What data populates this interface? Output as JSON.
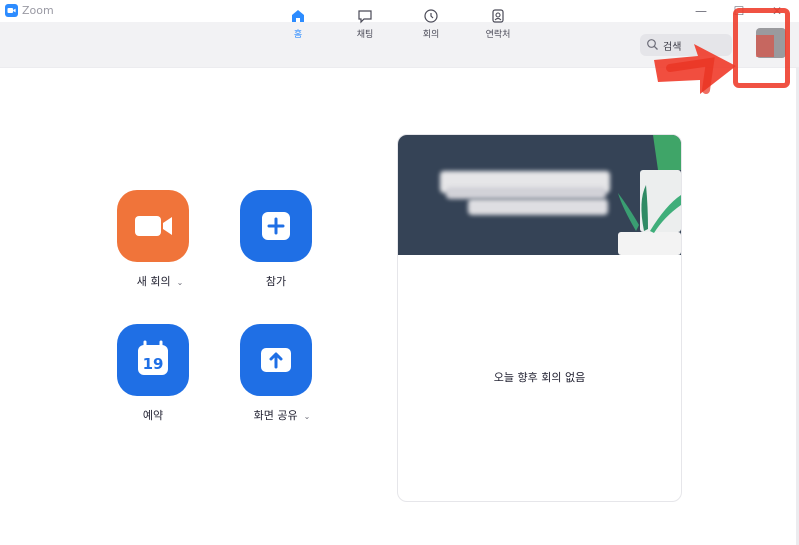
{
  "window": {
    "title": "Zoom",
    "controls": {
      "minimize": "—",
      "maximize": "☐",
      "close": "✕"
    }
  },
  "nav": {
    "tabs": [
      {
        "label": "홈",
        "icon": "home-icon",
        "active": true
      },
      {
        "label": "채팅",
        "icon": "chat-icon",
        "active": false
      },
      {
        "label": "회의",
        "icon": "clock-icon",
        "active": false
      },
      {
        "label": "연락처",
        "icon": "contacts-icon",
        "active": false
      }
    ],
    "search": {
      "placeholder": "검색",
      "icon": "search-icon"
    }
  },
  "actions": {
    "new_meeting": {
      "label": "새 회의",
      "icon": "video-camera-icon",
      "color": "#f0743a",
      "chevron": "⌄"
    },
    "join": {
      "label": "참가",
      "icon": "plus-icon",
      "color": "#1f6fe5"
    },
    "schedule": {
      "label": "예약",
      "icon": "calendar-icon",
      "day": "19",
      "color": "#1f6fe5"
    },
    "share_screen": {
      "label": "화면 공유",
      "icon": "share-up-arrow-icon",
      "color": "#1f6fe5",
      "chevron": "⌄"
    }
  },
  "meetings_card": {
    "empty_message": "오늘 향후 회의 없음"
  },
  "colors": {
    "accent": "#2d8cff",
    "nav_background": "#f2f2f4",
    "annotation": "#ef3b2a"
  }
}
